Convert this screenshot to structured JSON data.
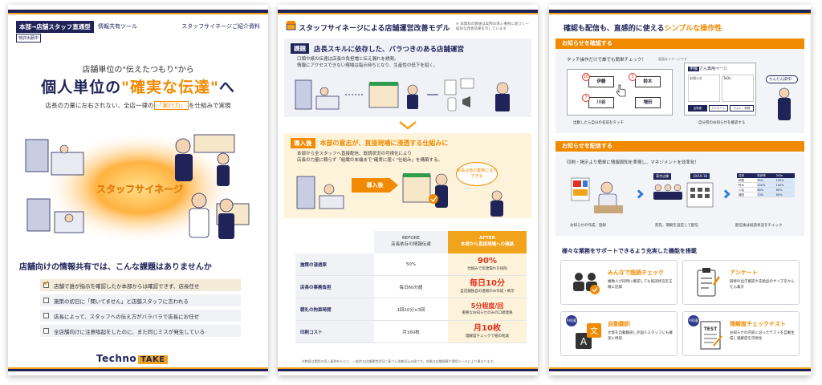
{
  "page1": {
    "badge": "本部→店舗スタッフ直通型",
    "tool": "情報共有ツール",
    "doc_title": "スタッフサイネージご紹介資料",
    "tag": "特許出願中",
    "hero_sub": "店舗単位の\"伝えたつもり\"から",
    "hero_a": "個人単位の",
    "hero_b": "\"確実な伝達\"",
    "hero_c": "へ",
    "desc_a": "店長の力量に左右されない、全店一律の",
    "desc_b": "「実行力」",
    "desc_c": "を仕組みで実現",
    "art_label": "スタッフサイネージ",
    "question": "店舗向けの情報共有では、こんな課題はありませんか",
    "checklist": [
      "店舗で誰が指示を確認したか本部からは確認できず、店長任せ",
      "施策の初日に「聞いてません」と店舗スタッフに言われる",
      "店長によって、スタッフへの伝え方がバラバラで店長にお任せ",
      "全店舗向けに注意喚起をしたのに、また同じミスが発生している"
    ],
    "logo_a": "Techno",
    "logo_b": "TAKE"
  },
  "page2": {
    "title": "スタッフサイネージによる店舗運営改善モデル",
    "note": "※ 本資料の数値は実際の導入事例に基づく一般的な改善効果を示しています",
    "issue_label": "課題",
    "issue_head": "店長スキルに依存した、バラつきのある店舗運営",
    "issue_line1": "口頭や紙の伝達は店長の負担増と伝え漏れを誘発。",
    "issue_line2": "情報にアクセスできない現場は指示待ちとなり、生産性の低下を招く。",
    "after_label": "導入後",
    "after_head": "本部の意志が、直接現場に浸透する仕組みに",
    "after_line1": "本部から全スタッフへ直接配信、既読状況の可視化により",
    "after_line2": "店長の力量に頼らず「組織の末端まで\"確実に届く\"仕組み」を構築する。",
    "arrow": "導入後",
    "bubble": "店長は他の業務に注力できる",
    "col_before_1": "BEFORE",
    "col_before_2": "店長依存の情報伝達",
    "col_after_1": "AFTER",
    "col_after_2": "本部から直接現場への連絡",
    "rows": [
      {
        "label": "施策の浸透率",
        "before": "50%",
        "after": "90%",
        "after_cap": "仕組みで伝達漏れを排除"
      },
      {
        "label": "店長の事務負担",
        "before": "毎日60分超",
        "after": "毎日10分",
        "after_cap": "自店舗独自の連絡のみ作成・掲示"
      },
      {
        "label": "朝礼の拘束時間",
        "before": "1回10分×3回",
        "after": "5分程度/回",
        "after_cap": "重要なお知らせのみの口頭連絡"
      },
      {
        "label": "印刷コスト",
        "before": "月160枚",
        "after": "月10枚",
        "after_cap": "理解度チェックで紙の削減"
      }
    ],
    "foot": "※数値は実際の導入事例をもとに、一般的な店舗運営状況に基づく改善見込み値です。効果は店舗規模や運用ルールにより異なります。"
  },
  "page3": {
    "title_a": "確認も配信も、直感的に使える",
    "title_b": "シンプルな操作性",
    "sec1": "お知らせを確認する",
    "sec1_cap": "タッチ操作だけで誰でも簡単チェック！",
    "sec1_note": "画面はイメージです",
    "names": [
      "伊藤",
      "鈴木",
      "川谷",
      "増田"
    ],
    "dots": [
      "10",
      "3",
      "7"
    ],
    "cap_a": "出勤したら自分の名前をタッチ",
    "page_name": "伊藤",
    "page_suffix": "さん専用ページ",
    "mini_a": "お知らせ",
    "mini_b": "ToDo",
    "mini_btn1": "出勤表",
    "mini_btn2": "アンケート",
    "mini_btn3": "テスト・研修",
    "speech": "かんたん操作！",
    "cap_b": "自分宛のお知らせを確認する",
    "sec2": "お知らせを配信する",
    "sec2_cap": "印刷・掲示より簡単に情報周知を実現し、マネジメントを効率化！",
    "step1": "お知らせの作成、登録",
    "step2": "宛先、期間を設定して配信",
    "step3": "配信後は既読状況をチェック",
    "store_tag": "東京店舗",
    "date_tag": "10/16-18",
    "t_head": [
      "名前",
      "既読率",
      "ToDo"
    ],
    "t_rows": [
      [
        "伊藤",
        "95%",
        "100%"
      ],
      [
        "鈴木",
        "100%",
        "100%"
      ],
      [
        "川谷",
        "80%",
        "80%"
      ],
      [
        "増田",
        "70%",
        "80%"
      ]
    ],
    "feat_title": "様々な業務をサポートできるよう充実した機能を搭載",
    "features": [
      {
        "title": "みんなで既読チェック",
        "desc": "複数人が同時に確認しても既読状況を正確に記録",
        "ai": ""
      },
      {
        "title": "アンケート",
        "desc": "研修の出欠確認や支給品のサイズをかんたん集計",
        "ai": ""
      },
      {
        "title": "自動翻訳",
        "desc": "文章を自動翻訳し外国人スタッフにも確実に周知",
        "ai": "AI搭載"
      },
      {
        "title": "理解度チェックテスト",
        "desc": "お知らせの内容に沿ったテストを自動生成し理解度を可視化",
        "ai": "AI搭載"
      }
    ],
    "test_label": "TEST"
  },
  "colors": {
    "navy": "#1f2358",
    "orange": "#f08a00",
    "yellow": "#f2a31c"
  }
}
